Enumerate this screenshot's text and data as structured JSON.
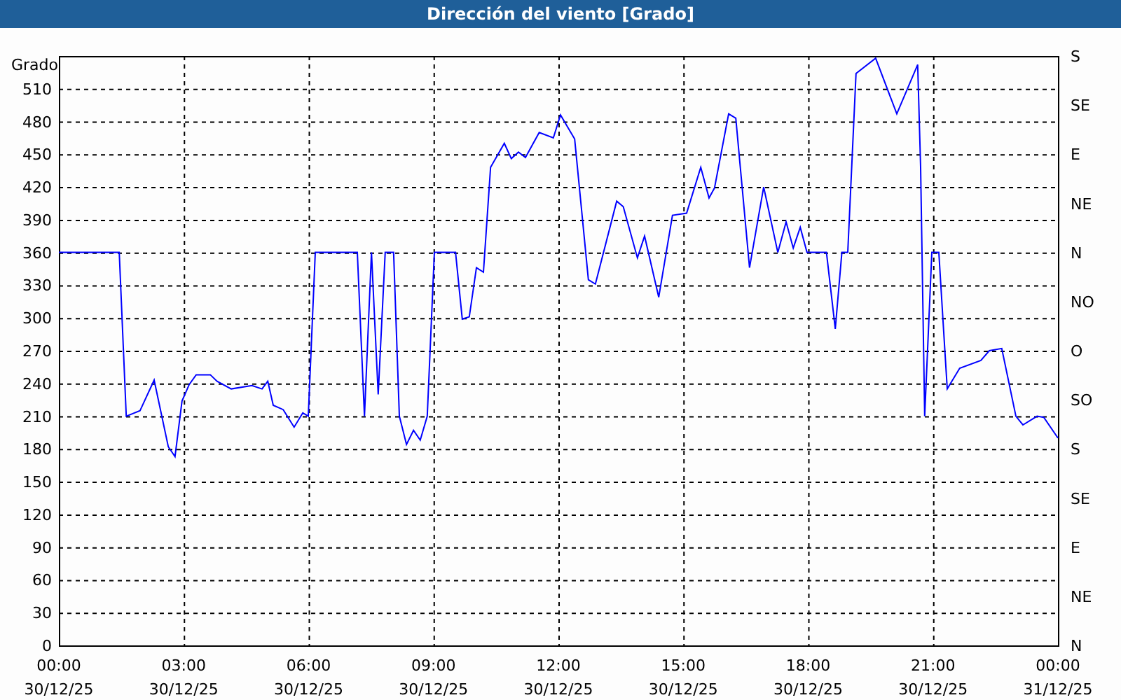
{
  "chart": {
    "right_axis_labels": [
      "S",
      "SE",
      "E",
      "NE",
      "N",
      "NO",
      "O",
      "SO",
      "S",
      "SE",
      "E",
      "NE",
      "N"
    ],
    "x_dates": [
      "30/12/25",
      "30/12/25",
      "30/12/25",
      "30/12/25",
      "30/12/25",
      "30/12/25",
      "30/12/25",
      "30/12/25",
      "31/12/25"
    ],
    "chart_data": {
      "type": "line",
      "grid": true,
      "title": "Dirección del viento [Grado]",
      "ylabel": "Grado",
      "xlim": [
        0,
        24
      ],
      "ylim": [
        0,
        540
      ],
      "xticks": [
        {
          "value": 0,
          "label": "00:00"
        },
        {
          "value": 3,
          "label": "03:00"
        },
        {
          "value": 6,
          "label": "06:00"
        },
        {
          "value": 9,
          "label": "09:00"
        },
        {
          "value": 12,
          "label": "12:00"
        },
        {
          "value": 15,
          "label": "15:00"
        },
        {
          "value": 18,
          "label": "18:00"
        },
        {
          "value": 21,
          "label": "21:00"
        },
        {
          "value": 24,
          "label": "00:00"
        }
      ],
      "yticks": [
        0,
        30,
        60,
        90,
        120,
        150,
        180,
        210,
        240,
        270,
        300,
        330,
        360,
        390,
        420,
        450,
        480,
        510
      ],
      "x": [
        0,
        1.45,
        1.62,
        1.95,
        2.29,
        2.63,
        2.79,
        2.96,
        3.13,
        3.3,
        3.64,
        3.8,
        4.14,
        4.64,
        4.88,
        5.02,
        5.15,
        5.39,
        5.65,
        5.86,
        5.99,
        6.16,
        7.17,
        7.34,
        7.51,
        7.67,
        7.84,
        8.04,
        8.18,
        8.35,
        8.52,
        8.68,
        8.85,
        9.02,
        9.53,
        9.69,
        9.86,
        10.03,
        10.2,
        10.37,
        10.7,
        10.87,
        11.04,
        11.21,
        11.54,
        11.88,
        12.05,
        12.39,
        12.72,
        12.89,
        13.4,
        13.56,
        13.9,
        14.07,
        14.41,
        14.74,
        15.08,
        15.42,
        15.62,
        15.75,
        16.09,
        16.26,
        16.59,
        16.93,
        17.27,
        17.47,
        17.64,
        17.81,
        17.97,
        18.44,
        18.65,
        18.81,
        18.95,
        19.15,
        19.62,
        20.13,
        20.63,
        20.7,
        20.8,
        20.97,
        21.14,
        21.24,
        21.34,
        21.64,
        22.15,
        22.35,
        22.65,
        22.99,
        23.16,
        23.5,
        23.66,
        24
      ],
      "series": [
        {
          "color": "#0000ff",
          "values": [
            360,
            360,
            210,
            215,
            243,
            182,
            173,
            224,
            239,
            248,
            248,
            242,
            235,
            238,
            235,
            242,
            220,
            216,
            200,
            213,
            210,
            360,
            360,
            210,
            360,
            230,
            360,
            360,
            210,
            184,
            197,
            188,
            210,
            360,
            360,
            299,
            301,
            346,
            342,
            438,
            460,
            446,
            452,
            447,
            470,
            465,
            486,
            464,
            335,
            331,
            407,
            402,
            355,
            375,
            319,
            394,
            396,
            438,
            410,
            419,
            487,
            483,
            346,
            420,
            360,
            388,
            364,
            383,
            360,
            360,
            290,
            360,
            360,
            524,
            538,
            487,
            532,
            438,
            210,
            360,
            360,
            297,
            235,
            254,
            261,
            270,
            272,
            210,
            202,
            210,
            209,
            190
          ]
        }
      ]
    }
  }
}
